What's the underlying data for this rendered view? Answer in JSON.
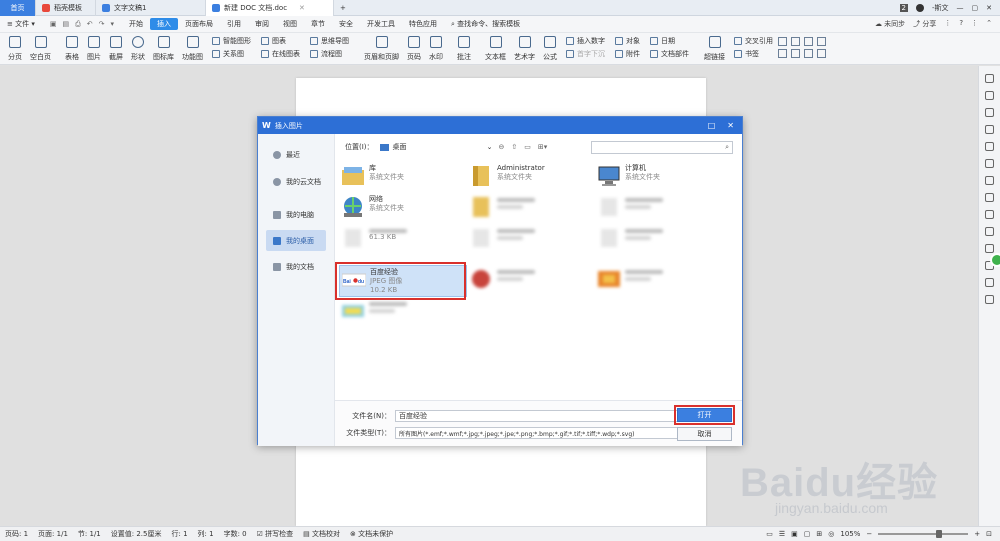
{
  "tabs": [
    {
      "label": "首页",
      "type": "home"
    },
    {
      "label": "稻壳模板",
      "icon": "docer-icon",
      "color": "#e8483b"
    },
    {
      "label": "文字文稿1",
      "icon": "writer-icon",
      "color": "#3b7fe0"
    },
    {
      "label": "新建 DOC 文档.doc",
      "icon": "writer-icon",
      "color": "#3b7fe0",
      "active": true
    }
  ],
  "tab_add": "+",
  "tab_badge": "2",
  "user": "-斯文",
  "menu": {
    "file": "文件",
    "items": [
      "开始",
      "插入",
      "页面布局",
      "引用",
      "审阅",
      "视图",
      "章节",
      "安全",
      "开发工具",
      "特色应用"
    ],
    "active": "插入",
    "search": "查找命令、搜索模板",
    "unsynced": "未同步",
    "share": "分享",
    "help": "?"
  },
  "ribbon": {
    "big": [
      "分页",
      "空白页",
      "表格",
      "图片",
      "截屏",
      "形状",
      "图标库",
      "功能图",
      "页眉和页脚",
      "页码",
      "水印",
      "批注",
      "文本框",
      "艺术字",
      "公式"
    ],
    "small_a": [
      "智能图形",
      "关系图"
    ],
    "small_b": [
      "图表",
      "在线图表"
    ],
    "small_c": [
      "思维导图",
      "流程图"
    ],
    "small_d": [
      "插入数字",
      "首字下沉"
    ],
    "small_e": [
      "对象",
      "附件"
    ],
    "small_f": [
      "日期",
      "文档部件"
    ],
    "small_g": [
      "超链接"
    ],
    "small_h": [
      "交叉引用",
      "书签"
    ]
  },
  "dialog": {
    "title": "插入图片",
    "nav": [
      {
        "label": "最近",
        "icon": "clock-icon"
      },
      {
        "label": "我的云文档",
        "icon": "cloud-icon"
      },
      {
        "label": "我的电脑",
        "icon": "computer-icon"
      },
      {
        "label": "我的桌面",
        "icon": "desktop-icon",
        "selected": true
      },
      {
        "label": "我的文档",
        "icon": "documents-icon"
      }
    ],
    "location_label": "位置(I)：",
    "location_value": "桌面",
    "files": [
      {
        "name": "库",
        "sub": "系统文件夹",
        "icon": "library-folder-icon"
      },
      {
        "name": "Administrator",
        "sub": "系统文件夹",
        "icon": "user-folder-icon"
      },
      {
        "name": "计算机",
        "sub": "系统文件夹",
        "icon": "computer-icon"
      },
      {
        "name": "网络",
        "sub": "系统文件夹",
        "icon": "network-icon"
      },
      {
        "name": "",
        "sub": "",
        "icon": "folder-icon",
        "blurred": true
      },
      {
        "name": "",
        "sub": "",
        "icon": "file-icon",
        "blurred": true
      },
      {
        "name": "",
        "sub": "61.3 KB",
        "icon": "file-icon",
        "blurred": true
      },
      {
        "name": "",
        "sub": "",
        "icon": "file-icon",
        "blurred": true
      },
      {
        "name": "",
        "sub": "",
        "icon": "file-icon",
        "blurred": true
      },
      {
        "name": "百度经验",
        "sub": "JPEG 图像",
        "size": "10.2 KB",
        "icon": "baidu-image-icon",
        "selected": true
      },
      {
        "name": "",
        "sub": "",
        "icon": "red-image-icon",
        "blurred": true
      },
      {
        "name": "",
        "sub": "",
        "icon": "orange-image-icon",
        "blurred": true
      },
      {
        "name": "",
        "sub": "",
        "icon": "yellow-image-icon",
        "blurred": true
      }
    ],
    "filename_label": "文件名(N)：",
    "filename_value": "百度经验",
    "filetype_label": "文件类型(T)：",
    "filetype_value": "所有图片(*.emf;*.wmf;*.jpg;*.jpeg;*.jpe;*.png;*.bmp;*.gif;*.tif;*.tiff;*.wdp;*.svg)",
    "open_label": "打开",
    "cancel_label": "取消"
  },
  "status": {
    "page": "页码: 1",
    "pages": "页面: 1/1",
    "section": "节: 1/1",
    "setting": "设置值: 2.5厘米",
    "row": "行: 1",
    "col": "列: 1",
    "words": "字数: 0",
    "spell": "拼写检查",
    "proof": "文档校对",
    "protect": "文档未保护",
    "zoom": "105%",
    "zoom_level_percent": 105
  },
  "watermark": {
    "brand": "Baidu经验",
    "url": "jingyan.baidu.com"
  },
  "colors": {
    "accent": "#2d6fd6",
    "highlight": "#d9302c",
    "selected_bg": "#cfe2f8"
  }
}
